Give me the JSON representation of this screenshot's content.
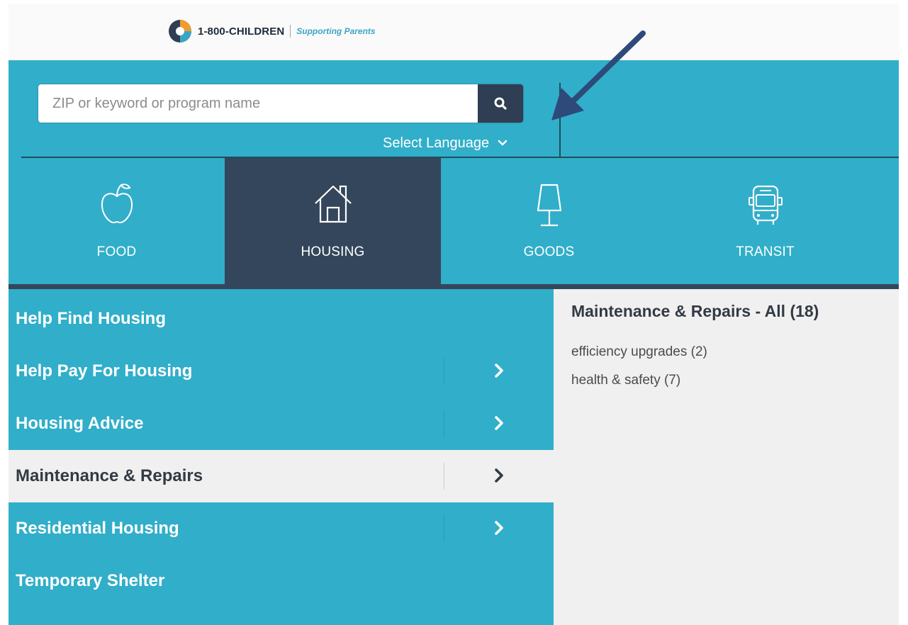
{
  "header": {
    "brand_name": "1-800-CHILDREN",
    "tagline": "Supporting Parents"
  },
  "search": {
    "placeholder": "ZIP or keyword or program name",
    "value": ""
  },
  "language": {
    "label": "Select Language"
  },
  "categories": [
    {
      "label": "FOOD",
      "icon": "apple-icon",
      "active": false
    },
    {
      "label": "HOUSING",
      "icon": "house-icon",
      "active": true
    },
    {
      "label": "GOODS",
      "icon": "lamp-icon",
      "active": false
    },
    {
      "label": "TRANSIT",
      "icon": "bus-icon",
      "active": false
    }
  ],
  "subcategories": [
    {
      "label": "Help Find Housing",
      "has_children": false
    },
    {
      "label": "Help Pay For Housing",
      "has_children": true
    },
    {
      "label": "Housing Advice",
      "has_children": true
    },
    {
      "label": "Maintenance & Repairs",
      "has_children": true,
      "active": true
    },
    {
      "label": "Residential Housing",
      "has_children": true
    },
    {
      "label": "Temporary Shelter",
      "has_children": false
    }
  ],
  "panel": {
    "title": "Maintenance & Repairs - All (18)",
    "items": [
      {
        "label": "efficiency upgrades (2)"
      },
      {
        "label": "health & safety (7)"
      }
    ]
  },
  "colors": {
    "teal": "#31aec9",
    "navy": "#34465b",
    "arrow": "#2d4a7a"
  }
}
